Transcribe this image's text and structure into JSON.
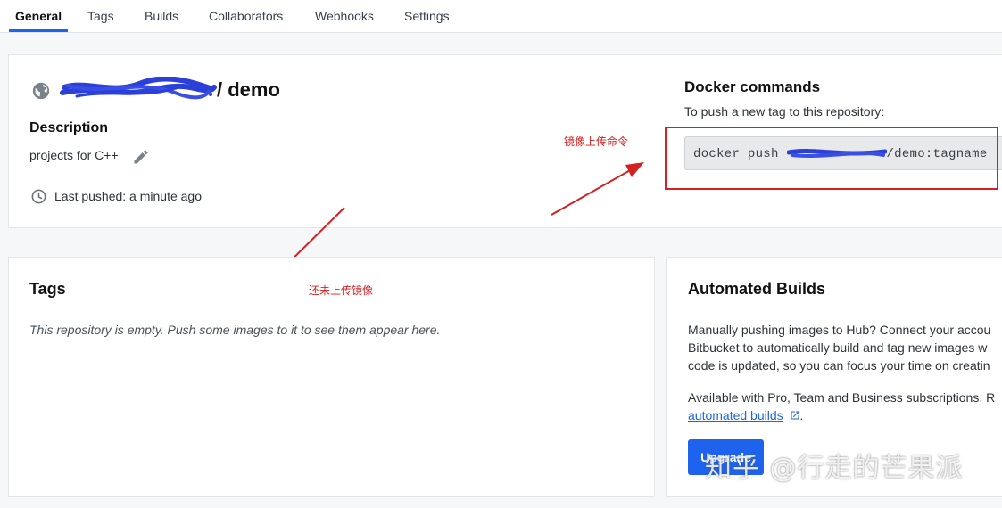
{
  "tabs": [
    {
      "label": "General",
      "active": true
    },
    {
      "label": "Tags",
      "active": false
    },
    {
      "label": "Builds",
      "active": false
    },
    {
      "label": "Collaborators",
      "active": false
    },
    {
      "label": "Webhooks",
      "active": false
    },
    {
      "label": "Settings",
      "active": false
    }
  ],
  "repo": {
    "name": "/ demo",
    "description_heading": "Description",
    "description": "projects for C++",
    "last_pushed": "Last pushed: a minute ago"
  },
  "docker": {
    "heading": "Docker commands",
    "subtext": "To push a new tag to this repository:",
    "cmd_prefix": "docker push",
    "cmd_suffix": "/demo:tagname"
  },
  "annotations": {
    "push_command": "镜像上传命令",
    "no_image": "还未上传镜像"
  },
  "tags_card": {
    "heading": "Tags",
    "empty_text": "This repository is empty. Push some images to it to see them appear here."
  },
  "builds_card": {
    "heading": "Automated Builds",
    "para1_line1": "Manually pushing images to Hub? Connect your accou",
    "para1_line2": "Bitbucket to automatically build and tag new images w",
    "para1_line3": "code is updated, so you can focus your time on creatin",
    "para2_line1": "Available with Pro, Team and Business subscriptions. R",
    "link_text": "automated builds",
    "link_after": ".",
    "button_label": "Upgrade"
  },
  "watermark": "知乎 @行走的芒果派",
  "colors": {
    "accent": "#1d63ed",
    "annotation_red": "#d42020",
    "scribble_blue": "#2b3fd9"
  }
}
